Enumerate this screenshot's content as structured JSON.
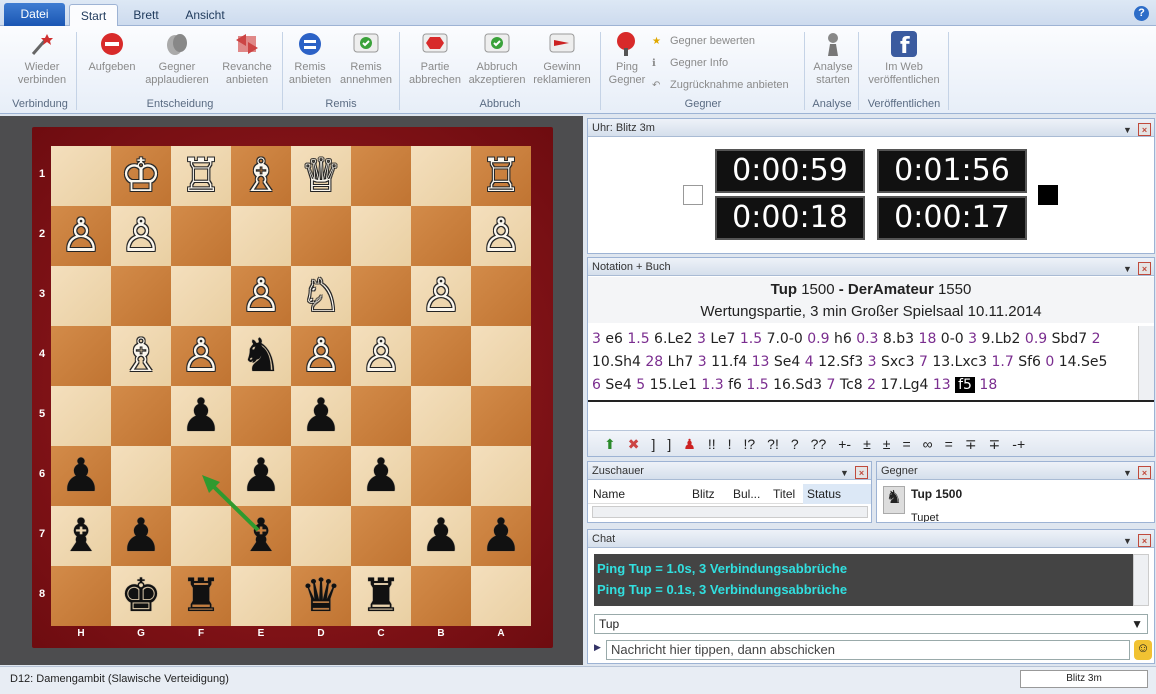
{
  "tabs": {
    "file": "Datei",
    "items": [
      "Start",
      "Brett",
      "Ansicht"
    ],
    "help": "?"
  },
  "ribbon": {
    "groups": [
      "Verbindung",
      "Entscheidung",
      "Remis",
      "Abbruch",
      "Gegner",
      "Analyse",
      "Veröffentlichen"
    ],
    "buttons": [
      {
        "l1": "Wieder",
        "l2": "verbinden"
      },
      {
        "l1": "Aufgeben",
        "l2": ""
      },
      {
        "l1": "Gegner",
        "l2": "applaudieren"
      },
      {
        "l1": "Revanche",
        "l2": "anbieten"
      },
      {
        "l1": "Remis",
        "l2": "anbieten"
      },
      {
        "l1": "Remis",
        "l2": "annehmen"
      },
      {
        "l1": "Partie",
        "l2": "abbrechen"
      },
      {
        "l1": "Abbruch",
        "l2": "akzeptieren"
      },
      {
        "l1": "Gewinn",
        "l2": "reklamieren"
      },
      {
        "l1": "Ping",
        "l2": "Gegner"
      },
      {
        "l1": "Analyse",
        "l2": "starten"
      },
      {
        "l1": "Im Web",
        "l2": "veröffentlichen"
      }
    ],
    "small": [
      "Gegner bewerten",
      "Gegner Info",
      "Zugrücknahme anbieten"
    ]
  },
  "board": {
    "ranks": [
      "1",
      "2",
      "3",
      "4",
      "5",
      "6",
      "7",
      "8"
    ],
    "files": [
      "H",
      "G",
      "F",
      "E",
      "D",
      "C",
      "B",
      "A"
    ],
    "pieces": [
      [
        "",
        "♔",
        "♖",
        "♗",
        "♕",
        "",
        "",
        "♖"
      ],
      [
        "♙",
        "♙",
        "",
        "",
        "",
        "",
        "",
        "♙"
      ],
      [
        "",
        "",
        "",
        "♙",
        "♘",
        "",
        "♙",
        ""
      ],
      [
        "",
        "♗",
        "♙",
        "♞",
        "♙",
        "♙",
        "",
        ""
      ],
      [
        "",
        "",
        "♟",
        "",
        "♟",
        "",
        "",
        ""
      ],
      [
        "♟",
        "",
        "",
        "♟",
        "",
        "♟",
        "",
        ""
      ],
      [
        "♝",
        "♟",
        "",
        "♝",
        "",
        "",
        "♟",
        "♟"
      ],
      [
        "",
        "♚",
        "♜",
        "",
        "♛",
        "♜",
        "",
        ""
      ]
    ]
  },
  "clock": {
    "title": "Uhr: Blitz 3m",
    "t1": "0:00:59",
    "t2": "0:01:56",
    "t3": "0:00:18",
    "t4": "0:00:17"
  },
  "notation": {
    "title": "Notation + Buch",
    "white": "Tup",
    "white_elo": "1500",
    "sep": " - ",
    "black": "DerAmateur",
    "black_elo": "1550",
    "event": "Wertungspartie, 3 min Großer Spielsaal 10.11.2014",
    "line1": [
      [
        "3",
        1
      ],
      [
        " e6 ",
        0
      ],
      [
        "1.5",
        1
      ],
      [
        " 6.Le2 ",
        0
      ],
      [
        "3",
        1
      ],
      [
        " Le7 ",
        0
      ],
      [
        "1.5",
        1
      ],
      [
        " 7.0-0 ",
        0
      ],
      [
        "0.9",
        1
      ],
      [
        " h6 ",
        0
      ],
      [
        "0.3",
        1
      ],
      [
        " 8.b3 ",
        0
      ],
      [
        "18",
        1
      ],
      [
        " 0-0 ",
        0
      ],
      [
        "3",
        1
      ],
      [
        " 9.Lb2 ",
        0
      ],
      [
        "0.9",
        1
      ],
      [
        " Sbd7 ",
        0
      ],
      [
        "2",
        1
      ]
    ],
    "line2": [
      [
        "10.Sh4 ",
        0
      ],
      [
        "28",
        1
      ],
      [
        " Lh7 ",
        0
      ],
      [
        "3",
        1
      ],
      [
        " 11.f4 ",
        0
      ],
      [
        "13",
        1
      ],
      [
        " Se4 ",
        0
      ],
      [
        "4",
        1
      ],
      [
        " 12.Sf3 ",
        0
      ],
      [
        "3",
        1
      ],
      [
        " Sxc3 ",
        0
      ],
      [
        "7",
        1
      ],
      [
        " 13.Lxc3 ",
        0
      ],
      [
        "1.7",
        1
      ],
      [
        " Sf6 ",
        0
      ],
      [
        "0",
        1
      ],
      [
        " 14.Se5",
        0
      ]
    ],
    "line3": [
      [
        "6",
        1
      ],
      [
        " Se4 ",
        0
      ],
      [
        "5",
        1
      ],
      [
        " 15.Le1 ",
        0
      ],
      [
        "1.3",
        1
      ],
      [
        " f6 ",
        0
      ],
      [
        "1.5",
        1
      ],
      [
        " 16.Sd3 ",
        0
      ],
      [
        "7",
        1
      ],
      [
        " Tc8 ",
        0
      ],
      [
        "2",
        1
      ],
      [
        " 17.Lg4 ",
        0
      ],
      [
        "13",
        1
      ],
      [
        " ",
        0
      ]
    ],
    "current_move": "f5",
    "current_time": "18",
    "symbols": [
      "!!",
      "!",
      "!?",
      "?!",
      "?",
      "??",
      "+-",
      "±",
      "±",
      "=",
      "∞",
      "=",
      "∓",
      "∓",
      "-+"
    ]
  },
  "spectators": {
    "title": "Zuschauer",
    "cols": [
      "Name",
      "Blitz",
      "Bul...",
      "Titel",
      "Status"
    ]
  },
  "opponent": {
    "title": "Gegner",
    "name": "Tup 1500",
    "sub": "Tupet"
  },
  "chat": {
    "title": "Chat",
    "lines": [
      "Ping Tup = 1.0s, 3 Verbindungsabbrüche",
      "Ping Tup = 0.1s, 3 Verbindungsabbrüche"
    ],
    "recipient": "Tup",
    "placeholder": "Nachricht hier tippen, dann abschicken"
  },
  "status": {
    "opening": "D12: Damengambit (Slawische Verteidigung)",
    "mode": "Blitz 3m"
  }
}
